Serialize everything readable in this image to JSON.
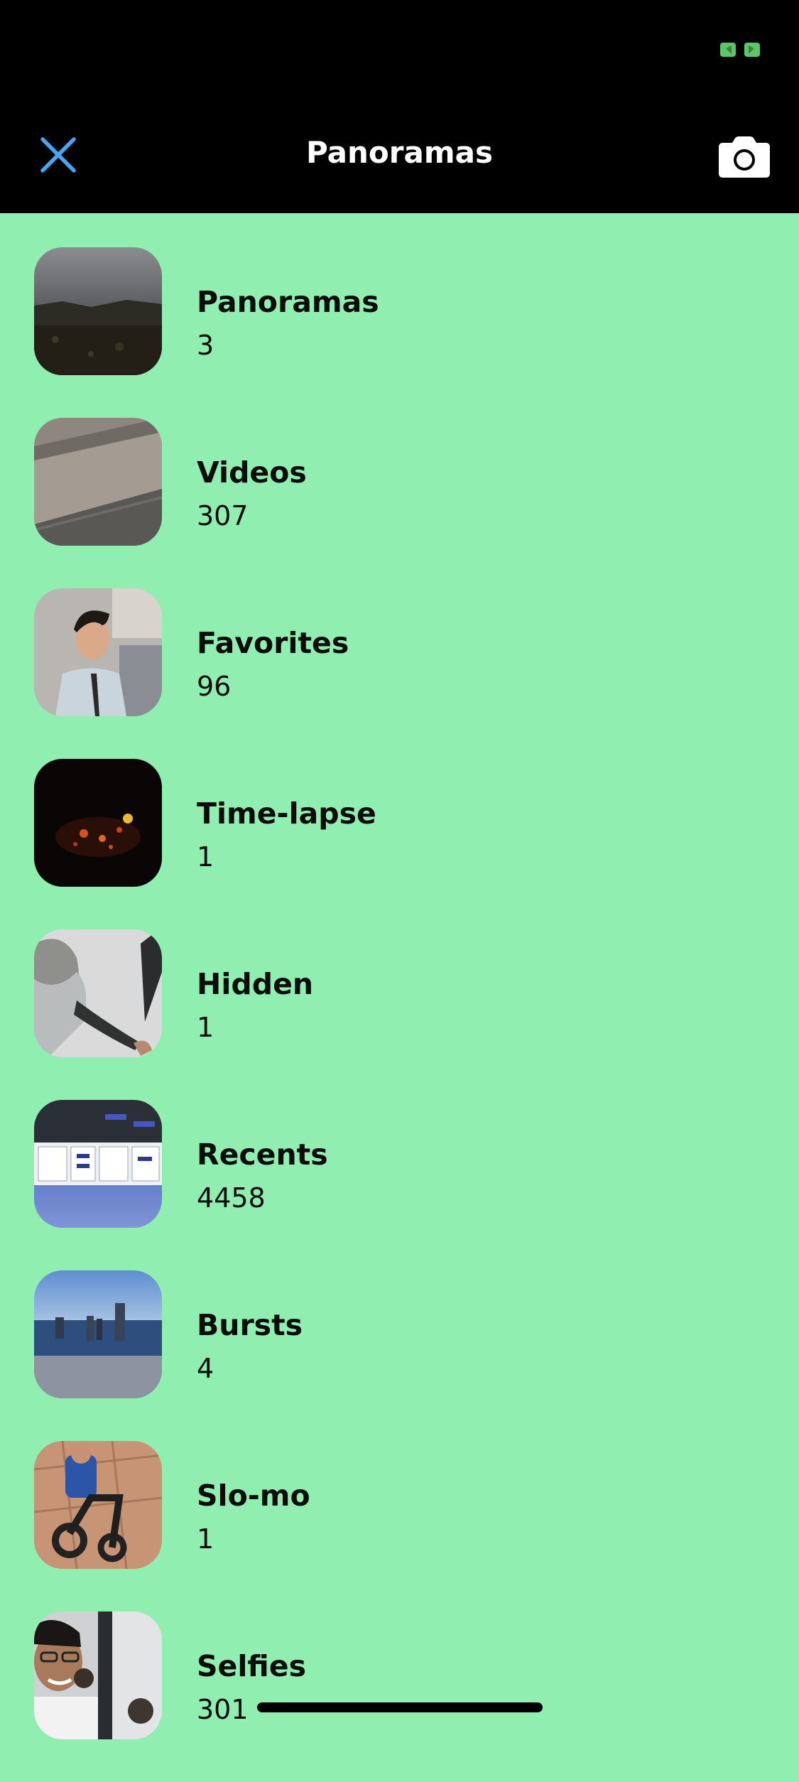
{
  "header": {
    "title": "Panoramas",
    "close_icon": "close-icon",
    "camera_icon": "camera-icon",
    "accent_color": "#4AA3F0"
  },
  "albums": [
    {
      "name": "Panoramas",
      "count": "3"
    },
    {
      "name": "Videos",
      "count": "307"
    },
    {
      "name": "Favorites",
      "count": "96"
    },
    {
      "name": "Time-lapse",
      "count": "1"
    },
    {
      "name": "Hidden",
      "count": "1"
    },
    {
      "name": "Recents",
      "count": "4458"
    },
    {
      "name": "Bursts",
      "count": "4"
    },
    {
      "name": "Slo-mo",
      "count": "1"
    },
    {
      "name": "Selfies",
      "count": "301"
    }
  ],
  "colors": {
    "background": "#90EEB0",
    "header_background": "#000000",
    "text": "#0c0c0c"
  }
}
